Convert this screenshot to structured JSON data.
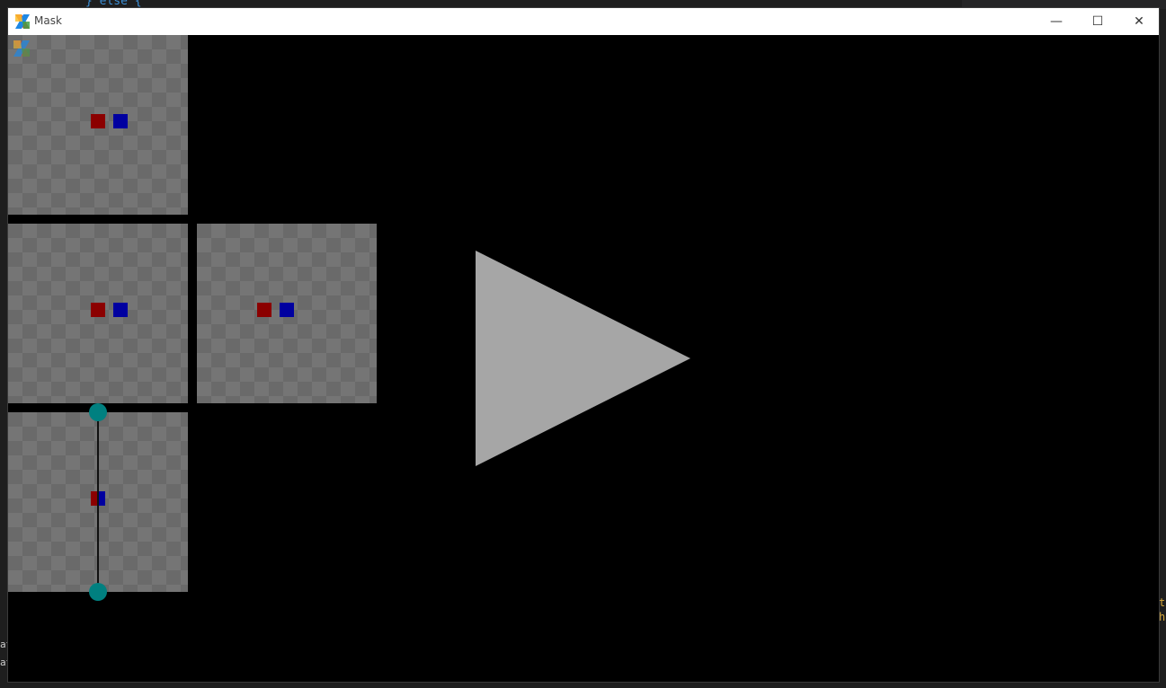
{
  "background_editor": {
    "code_line": "} else {",
    "right_snippets": [
      "t",
      "h"
    ],
    "left_snippets": [
      "at",
      "at"
    ]
  },
  "window": {
    "title": "Mask",
    "controls": {
      "minimize": "—",
      "maximize": "☐",
      "close": "✕"
    }
  },
  "canvas": {
    "background": "#000000",
    "checker_colors": [
      "#6a6a6a",
      "#757575"
    ],
    "square_red": "#8b0000",
    "square_blue": "#0000a0",
    "triangle_color": "#a6a6a6",
    "handle_color": "#008080",
    "panels": [
      {
        "name": "panel-top-left"
      },
      {
        "name": "panel-middle-left"
      },
      {
        "name": "panel-middle-right"
      },
      {
        "name": "panel-bottom-left"
      }
    ]
  }
}
